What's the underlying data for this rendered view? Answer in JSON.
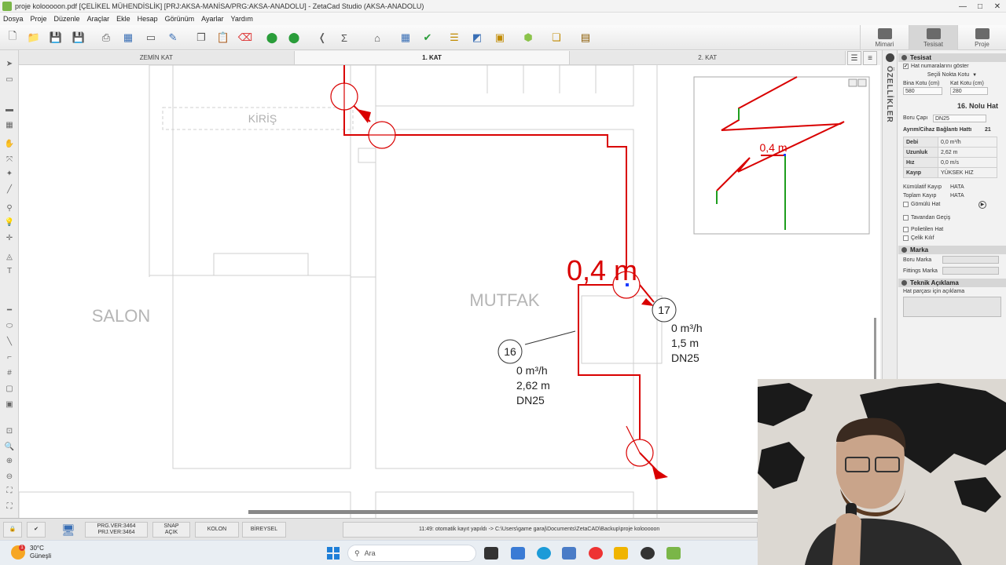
{
  "window": {
    "title": "proje kolooooon.pdf  [ÇELİKEL MÜHENDİSLİK]  [PRJ:AKSA-MANİSA/PRG:AKSA-ANADOLU]  - ZetaCad Studio (AKSA-ANADOLU)",
    "controls": [
      "—",
      "□",
      "✕"
    ]
  },
  "menu": [
    "Dosya",
    "Proje",
    "Düzenle",
    "Araçlar",
    "Ekle",
    "Hesap",
    "Görünüm",
    "Ayarlar",
    "Yardım"
  ],
  "mode_tabs": [
    {
      "label": "Mimari",
      "icon": "architecture-icon"
    },
    {
      "label": "Tesisat",
      "icon": "installation-icon"
    },
    {
      "label": "Proje",
      "icon": "project-icon"
    }
  ],
  "floor_tabs": [
    "ZEMİN KAT",
    "1. KAT",
    "2. KAT"
  ],
  "side_label": "ÖZELLİKLER",
  "canvas": {
    "rooms": [
      "SALON",
      "MUTFAK",
      "KİRİŞ"
    ],
    "dimension_text": "0,4 m",
    "pipe_labels": [
      {
        "no": "17",
        "flow": "0 m³/h",
        "length": "1,5 m",
        "dn": "DN25"
      },
      {
        "no": "16",
        "flow": "0 m³/h",
        "length": "2,62 m",
        "dn": "DN25"
      }
    ],
    "preview_dimension": "0,4 m",
    "colors": {
      "pipe": "#d90000",
      "riser": "#1e9e1e",
      "wall": "#c8c8c8"
    }
  },
  "properties": {
    "section_tesisat": "Tesisat",
    "show_line_numbers": "Hat numaralarını göster",
    "selected_point_elev": "Seçili Nokta Kotu",
    "building_elev_label": "Bina Kotu (cm)",
    "building_elev": "580",
    "floor_elev_label": "Kat Kotu (cm)",
    "floor_elev": "280",
    "line_title": "16. Nolu Hat",
    "pipe_diameter_label": "Boru Çapı",
    "pipe_diameter": "DN25",
    "connection_label": "Ayrım/Cihaz Bağlantı Hattı",
    "connection_value": "21",
    "rows": [
      {
        "k": "Debi",
        "v": "0,0 m³/h"
      },
      {
        "k": "Uzunluk",
        "v": "2,62 m"
      },
      {
        "k": "Hız",
        "v": "0,0 m/s"
      },
      {
        "k": "Kayıp",
        "v": "YÜKSEK HIZ"
      }
    ],
    "cumulative_loss_label": "Kümülatif Kayıp",
    "cumulative_loss": "HATA",
    "total_loss_label": "Toplam Kayıp",
    "total_loss": "HATA",
    "embedded_line": "Gömülü Hat",
    "ceiling_pass": "Tavandan Geçiş",
    "polyethylene": "Polietilen Hat",
    "steel_fitting": "Çelik Kılıf",
    "section_marka": "Marka",
    "pipe_brand": "Boru Marka",
    "fitting_brand": "Fittings Marka",
    "section_tech": "Teknik Açıklama",
    "tech_hint": "Hat parçası için açıklama"
  },
  "status": {
    "prg_ver": "PRG.VER:3464",
    "prj_ver": "PRJ.VER:3464",
    "snap": "SNAP",
    "snap_state": "AÇIK",
    "kolon": "KOLON",
    "bireysel": "BİREYSEL",
    "message": "11:49: otomatik kayıt yapıldı -> C:\\Users\\game garaj\\Documents\\ZetaCAD\\Backup\\proje kolooooon"
  },
  "taskbar": {
    "temp": "30°C",
    "weather": "Güneşli",
    "search_placeholder": "Ara"
  }
}
